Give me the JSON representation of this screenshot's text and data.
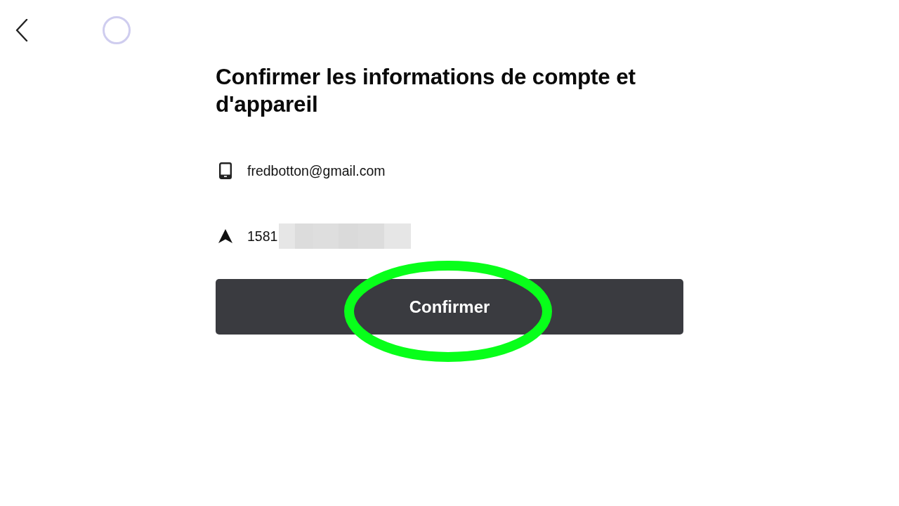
{
  "top_bar": {
    "loading": true
  },
  "title": "Confirmer les informations de compte et d'appareil",
  "details": [
    {
      "kind": "phone",
      "text": "fredbotton@gmail.com",
      "redacted": false
    },
    {
      "kind": "location",
      "text": "1581",
      "redacted": true
    }
  ],
  "confirm_button": {
    "label": "Confirmer",
    "highlighted": true
  }
}
